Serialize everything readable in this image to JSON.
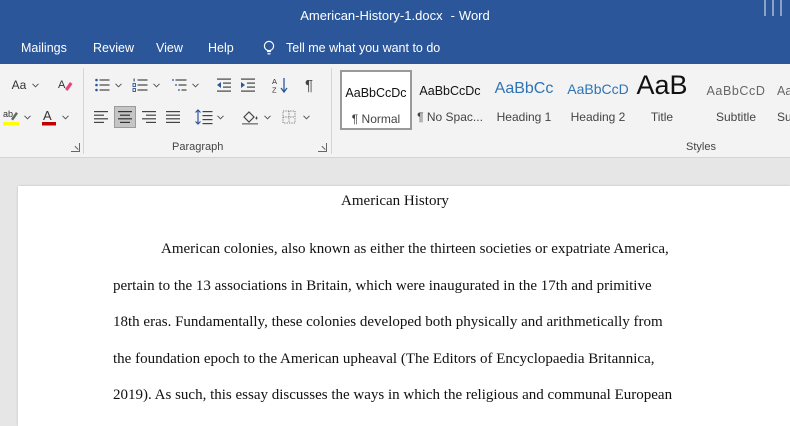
{
  "window": {
    "doc_name": "American-History-1.docx",
    "separator": "-",
    "app_name": "Word"
  },
  "menu": {
    "items": [
      "Mailings",
      "Review",
      "View",
      "Help"
    ],
    "tell_me": "Tell me what you want to do"
  },
  "ribbon": {
    "font_group": {
      "change_case_label": "Aa"
    },
    "paragraph_group": {
      "label": "Paragraph",
      "align_center_active": true
    },
    "styles_group": {
      "label": "Styles",
      "items": [
        {
          "preview": "AaBbCcDc",
          "name": "¶ Normal",
          "selected": true
        },
        {
          "preview": "AaBbCcDc",
          "name": "¶ No Spac...",
          "selected": false
        },
        {
          "preview": "AaBbCc",
          "name": "Heading 1",
          "selected": false
        },
        {
          "preview": "AaBbCcD",
          "name": "Heading 2",
          "selected": false
        },
        {
          "preview": "AaB",
          "name": "Title",
          "selected": false
        },
        {
          "preview": "AaBbCcD",
          "name": "Subtitle",
          "selected": false
        },
        {
          "preview": "AaBbCcD",
          "name": "Su",
          "selected": false
        }
      ]
    },
    "colors": {
      "highlight": "#ffff00",
      "font_color": "#c00000",
      "accent": "#2b579a"
    }
  },
  "document": {
    "title": "American History",
    "lines": [
      "American colonies, also known as either the thirteen societies or expatriate America,",
      "pertain to the 13 associations in Britain, which were inaugurated in the 17th and primitive",
      "18th eras. Fundamentally, these colonies developed both physically and arithmetically from",
      "the foundation epoch to the American upheaval (The Editors of Encyclopaedia Britannica,",
      "2019). As such, this essay discusses the ways in which the religious and communal European"
    ]
  }
}
